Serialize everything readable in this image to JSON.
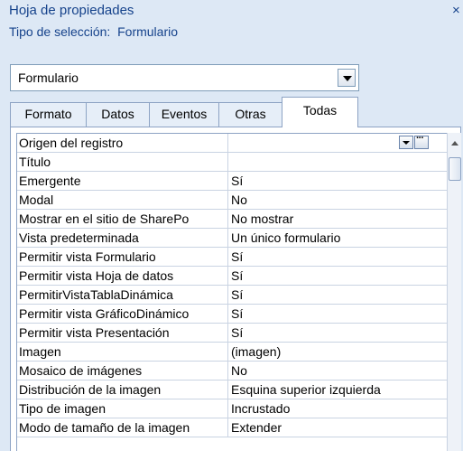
{
  "window": {
    "title": "Hoja de propiedades",
    "close": "×"
  },
  "selection_type": {
    "label": "Tipo de selección:",
    "value": "Formulario"
  },
  "object_combo": {
    "value": "Formulario"
  },
  "tabs": [
    "Formato",
    "Datos",
    "Eventos",
    "Otras",
    "Todas"
  ],
  "active_tab": "Todas",
  "properties": [
    {
      "name": "Origen del registro",
      "value": ""
    },
    {
      "name": "Título",
      "value": ""
    },
    {
      "name": "Emergente",
      "value": "Sí"
    },
    {
      "name": "Modal",
      "value": "No"
    },
    {
      "name": "Mostrar en el sitio de SharePo",
      "value": "No mostrar"
    },
    {
      "name": "Vista predeterminada",
      "value": "Un único formulario"
    },
    {
      "name": "Permitir vista Formulario",
      "value": "Sí"
    },
    {
      "name": "Permitir vista Hoja de datos",
      "value": "Sí"
    },
    {
      "name": "PermitirVistaTablaDinámica",
      "value": "Sí"
    },
    {
      "name": "Permitir vista GráficoDinámico",
      "value": "Sí"
    },
    {
      "name": "Permitir vista Presentación",
      "value": "Sí"
    },
    {
      "name": "Imagen",
      "value": "(imagen)"
    },
    {
      "name": "Mosaico de imágenes",
      "value": "No"
    },
    {
      "name": "Distribución de la imagen",
      "value": "Esquina superior izquierda"
    },
    {
      "name": "Tipo de imagen",
      "value": "Incrustado"
    },
    {
      "name": "Modo de tamaño de la imagen",
      "value": "Extender"
    }
  ],
  "icons": {
    "combo_dropdown": "chevron-down-icon",
    "row_dropdown": "chevron-down-icon",
    "row_builder": "ellipsis-icon",
    "scroll_up": "arrow-up-icon"
  }
}
